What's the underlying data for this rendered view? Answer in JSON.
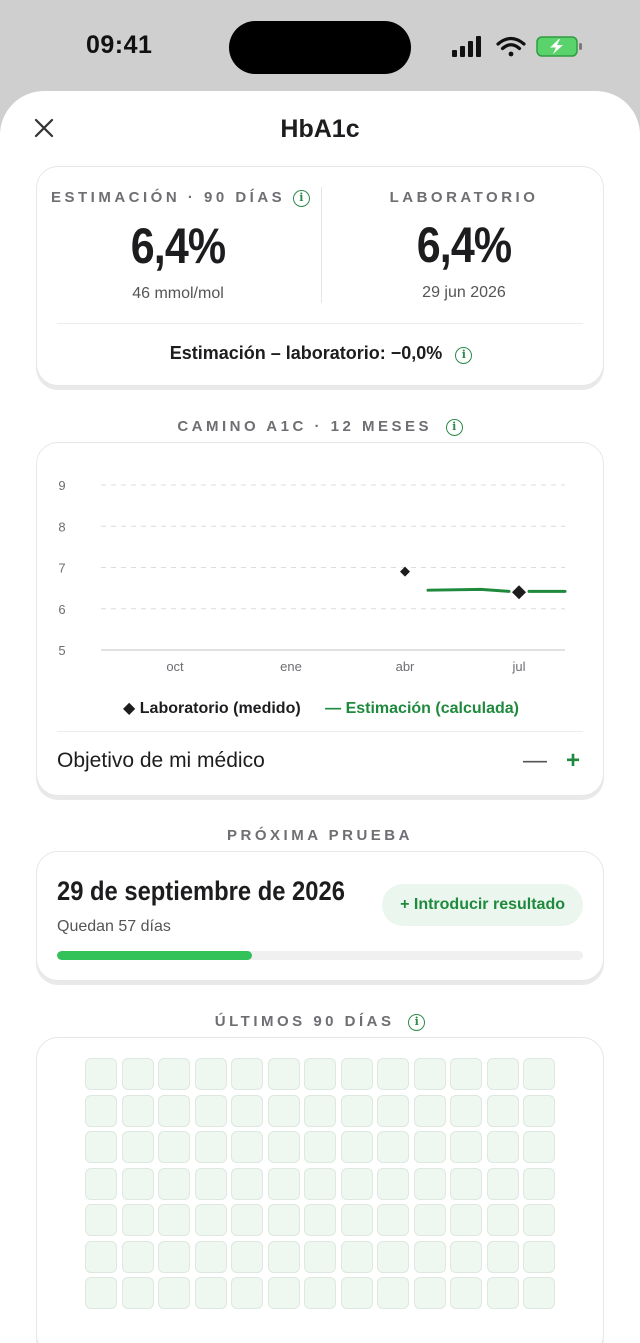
{
  "status": {
    "time": "09:41"
  },
  "sheet": {
    "title": "HbA1c",
    "close_icon": "close-icon"
  },
  "kpi": {
    "estimate": {
      "label": "ESTIMACIÓN · 90 DÍAS",
      "value": "6,4%",
      "sub": "46 mmol/mol"
    },
    "lab": {
      "label": "LABORATORIO",
      "value": "6,4%",
      "sub": "29 jun 2026"
    },
    "diff": "Estimación – laboratorio: −0,0%"
  },
  "path": {
    "section_label": "CAMINO A1C · 12 MESES"
  },
  "chart_data": {
    "type": "line",
    "ylim": [
      5,
      9
    ],
    "yticks": [
      "9",
      "8",
      "7",
      "6",
      "5"
    ],
    "xticks": [
      "oct",
      "ene",
      "abr",
      "jul"
    ],
    "grid": true,
    "series": [
      {
        "name": "Laboratorio (medido)",
        "marker": "diamond",
        "color": "#1d1d1f",
        "points": [
          {
            "x": "abr",
            "y": 6.9
          },
          {
            "x": "jul",
            "y": 6.4
          }
        ]
      },
      {
        "name": "Estimación (calculada)",
        "color": "#1f8a3d",
        "points": [
          {
            "x": "may",
            "y": 6.45
          },
          {
            "x": "jun",
            "y": 6.47
          },
          {
            "x": "jul",
            "y": 6.42
          }
        ]
      }
    ],
    "legend": {
      "lab": "◆ Laboratorio (medido)",
      "est": "— Estimación (calculada)",
      "position": "bottom"
    }
  },
  "goal": {
    "label": "Objetivo de mi médico",
    "minus": "—",
    "plus": "+"
  },
  "next_test": {
    "section_label": "PRÓXIMA PRUEBA",
    "date": "29 de septiembre de 2026",
    "remaining": "Quedan 57 días",
    "button": "+ Introducir resultado",
    "progress": 0.37
  },
  "last90": {
    "section_label": "ÚLTIMOS 90 DÍAS",
    "visible_cells": 91
  },
  "colors": {
    "accent": "#1f8a3d",
    "progress": "#33c159",
    "sheet_bg": "#ffffff"
  }
}
